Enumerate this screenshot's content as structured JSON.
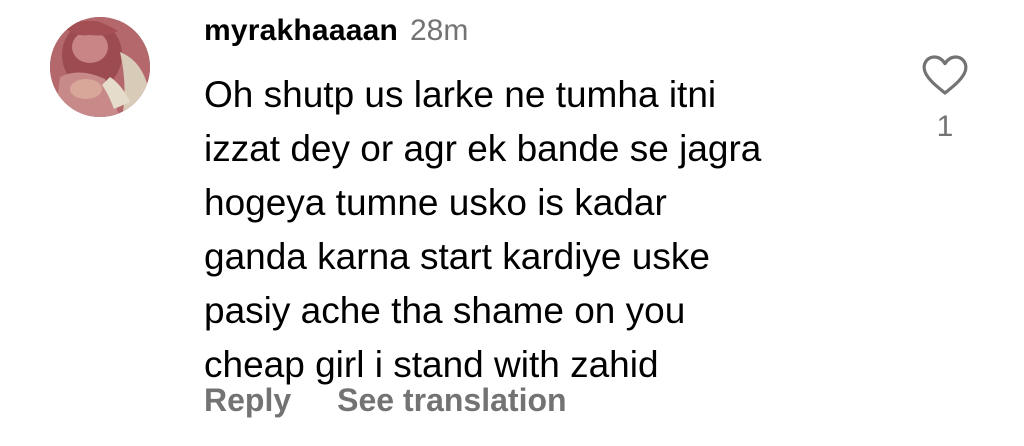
{
  "comment": {
    "username": "myrakhaaaan",
    "timestamp": "28m",
    "text_lines": [
      "Oh shutp us larke ne tumha itni",
      "izzat dey or agr ek bande se jagra",
      "hogeya tumne usko is kadar",
      "ganda karna start kardiye uske",
      "pasiy ache tha shame on you",
      "cheap girl i stand with zahid"
    ],
    "actions": {
      "reply_label": "Reply",
      "translate_label": "See translation"
    },
    "likes": {
      "count": "1",
      "icon": "heart-outline-icon"
    },
    "avatar_icon": "profile-photo"
  },
  "colors": {
    "primary_text": "#000000",
    "secondary_text": "#737373",
    "background": "#ffffff"
  }
}
